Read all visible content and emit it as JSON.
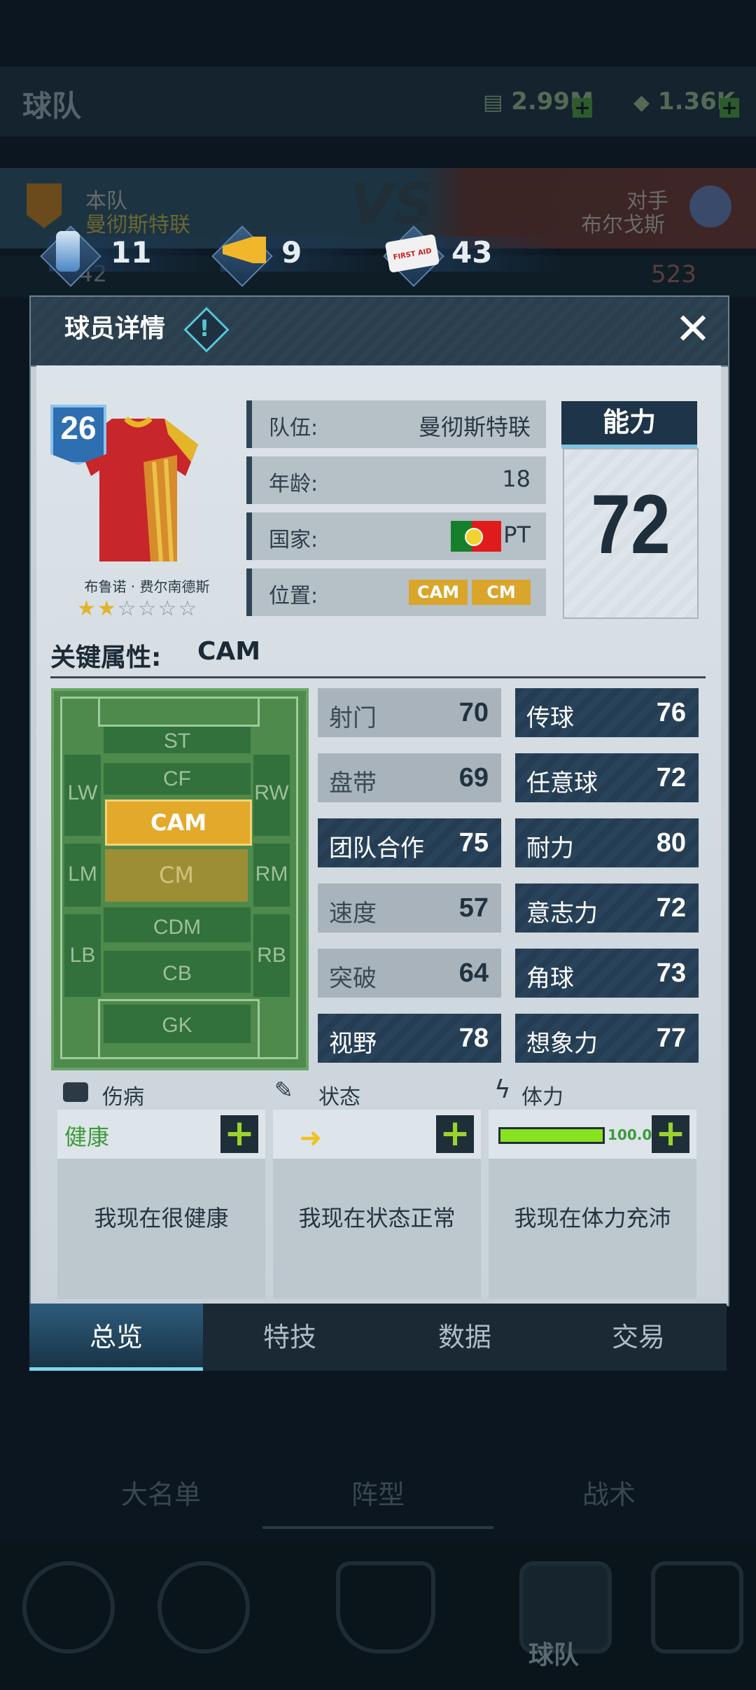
{
  "background": {
    "title": "球队",
    "coins": "2.99M",
    "gems": "1.36K",
    "home_label": "本队",
    "home_team": "曼彻斯特联",
    "vs": "VS",
    "away_label": "对手",
    "away_team": "布尔戈斯",
    "home_value": "442",
    "away_value": "523",
    "subtabs": [
      "大名单",
      "阵型",
      "战术"
    ],
    "nav_label": "球队"
  },
  "resources": [
    {
      "icon": "drink-can-icon",
      "value": "11"
    },
    {
      "icon": "megaphone-icon",
      "value": "9"
    },
    {
      "icon": "first-aid-kit-icon",
      "value": "43"
    }
  ],
  "first_aid_text": "FIRST AID",
  "modal": {
    "title": "球员详情",
    "info_mark": "!",
    "close": "✕"
  },
  "player": {
    "number": "26",
    "name": "布鲁诺 · 费尔南德斯",
    "stars_filled": 2,
    "stars_total": 6,
    "star_on": "★★",
    "star_off": "☆☆☆☆",
    "team_label": "队伍:",
    "team": "曼彻斯特联",
    "age_label": "年龄:",
    "age": "18",
    "country_label": "国家:",
    "country": "PT",
    "position_label": "位置:",
    "positions": [
      "CAM",
      "CM"
    ],
    "ability_label": "能力",
    "ability": "72"
  },
  "key_attr_label": "关键属性:",
  "key_attr_value": "CAM",
  "pitch_positions": {
    "ST": "ST",
    "CF": "CF",
    "LW": "LW",
    "RW": "RW",
    "CAM": "CAM",
    "LM": "LM",
    "CM": "CM",
    "RM": "RM",
    "CDM": "CDM",
    "LB": "LB",
    "RB": "RB",
    "CB": "CB",
    "GK": "GK"
  },
  "attributes_left": [
    {
      "label": "射门",
      "value": "70",
      "style": "light"
    },
    {
      "label": "盘带",
      "value": "69",
      "style": "light"
    },
    {
      "label": "团队合作",
      "value": "75",
      "style": "dark"
    },
    {
      "label": "速度",
      "value": "57",
      "style": "light"
    },
    {
      "label": "突破",
      "value": "64",
      "style": "light"
    },
    {
      "label": "视野",
      "value": "78",
      "style": "dark"
    }
  ],
  "attributes_right": [
    {
      "label": "传球",
      "value": "76"
    },
    {
      "label": "任意球",
      "value": "72"
    },
    {
      "label": "耐力",
      "value": "80"
    },
    {
      "label": "意志力",
      "value": "72"
    },
    {
      "label": "角球",
      "value": "73"
    },
    {
      "label": "想象力",
      "value": "77"
    }
  ],
  "status": {
    "injury_label": "伤病",
    "injury_value": "健康",
    "injury_desc": "我现在很健康",
    "form_label": "状态",
    "form_desc": "我现在状态正常",
    "stamina_label": "体力",
    "stamina_value": "100.0%",
    "stamina_fraction": 1.0,
    "stamina_desc": "我现在体力充沛",
    "plus": "+"
  },
  "tabs": [
    "总览",
    "特技",
    "数据",
    "交易"
  ],
  "active_tab": 0
}
